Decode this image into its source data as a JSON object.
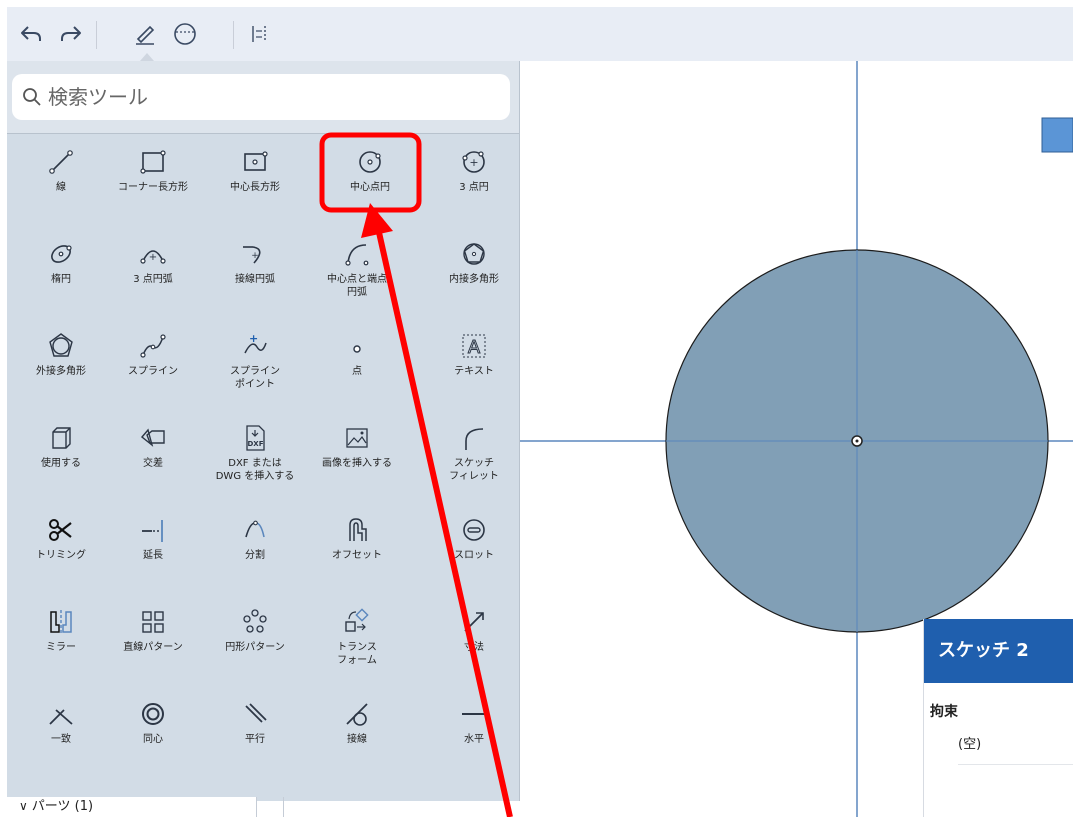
{
  "search": {
    "placeholder": "検索ツール"
  },
  "tools": [
    {
      "id": "line",
      "label": "線"
    },
    {
      "id": "corner-rect",
      "label": "コーナー長方形"
    },
    {
      "id": "center-rect",
      "label": "中心長方形"
    },
    {
      "id": "center-circle",
      "label": "中心点円"
    },
    {
      "id": "three-point-circle",
      "label": "3 点円"
    },
    {
      "id": "ellipse",
      "label": "楕円"
    },
    {
      "id": "three-point-arc",
      "label": "3 点円弧"
    },
    {
      "id": "tangent-arc",
      "label": "接線円弧"
    },
    {
      "id": "center-point-arc",
      "label": "中心点と端点\n円弧"
    },
    {
      "id": "inscribed-polygon",
      "label": "内接多角形"
    },
    {
      "id": "circumscribed-polygon",
      "label": "外接多角形"
    },
    {
      "id": "spline",
      "label": "スプライン"
    },
    {
      "id": "spline-point",
      "label": "スプライン\nポイント"
    },
    {
      "id": "point",
      "label": "点"
    },
    {
      "id": "text",
      "label": "テキスト"
    },
    {
      "id": "use",
      "label": "使用する"
    },
    {
      "id": "intersect",
      "label": "交差"
    },
    {
      "id": "dxf-insert",
      "label": "DXF または\nDWG を挿入する"
    },
    {
      "id": "image-insert",
      "label": "画像を挿入する"
    },
    {
      "id": "sketch-fillet",
      "label": "スケッチ\nフィレット"
    },
    {
      "id": "trim",
      "label": "トリミング"
    },
    {
      "id": "extend",
      "label": "延長"
    },
    {
      "id": "split",
      "label": "分割"
    },
    {
      "id": "offset",
      "label": "オフセット"
    },
    {
      "id": "slot",
      "label": "スロット"
    },
    {
      "id": "mirror",
      "label": "ミラー"
    },
    {
      "id": "linear-pattern",
      "label": "直線パターン"
    },
    {
      "id": "circular-pattern",
      "label": "円形パターン"
    },
    {
      "id": "transform",
      "label": "トランス\nフォーム"
    },
    {
      "id": "dimension",
      "label": "寸法"
    },
    {
      "id": "coincident",
      "label": "一致"
    },
    {
      "id": "concentric",
      "label": "同心"
    },
    {
      "id": "parallel",
      "label": "平行"
    },
    {
      "id": "tangent",
      "label": "接線"
    },
    {
      "id": "horizontal",
      "label": "水平"
    }
  ],
  "parts": {
    "label": "パーツ (1)"
  },
  "sketch_panel": {
    "title": "スケッチ 2",
    "constraints_title": "拘束",
    "constraints_empty": "(空)"
  },
  "colors": {
    "toolbar_bg": "#e8edf5",
    "panel_bg": "#d2dce6",
    "circle_fill": "#819fb6",
    "axis": "#5b87bd",
    "highlight": "#ff0000",
    "sketch_header": "#1f5fae"
  }
}
